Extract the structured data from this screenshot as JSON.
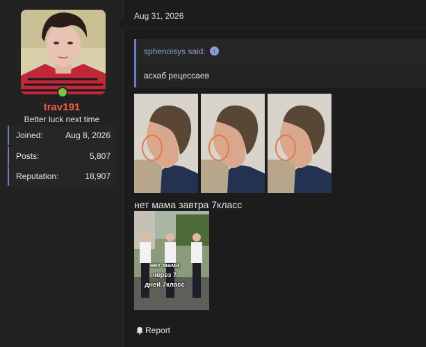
{
  "user": {
    "username": "trav191",
    "title": "Better luck next time",
    "stats": [
      {
        "label": "Joined:",
        "value": "Aug 8, 2026"
      },
      {
        "label": "Posts:",
        "value": "5,807"
      },
      {
        "label": "Reputation:",
        "value": "18,907"
      }
    ]
  },
  "post": {
    "date": "Aug 31, 2026",
    "quote": {
      "author_line": "sphenoisys said:",
      "text": "асхаб рецессаев"
    },
    "text": "нет мама завтра 7класс",
    "photo_caption": "нет мама через 7 дней 7класс",
    "report_label": "Report"
  },
  "colors": {
    "accent": "#6b7cc9",
    "username": "#f05a4a",
    "online": "#7dc242",
    "background": "#1c1c1c"
  }
}
